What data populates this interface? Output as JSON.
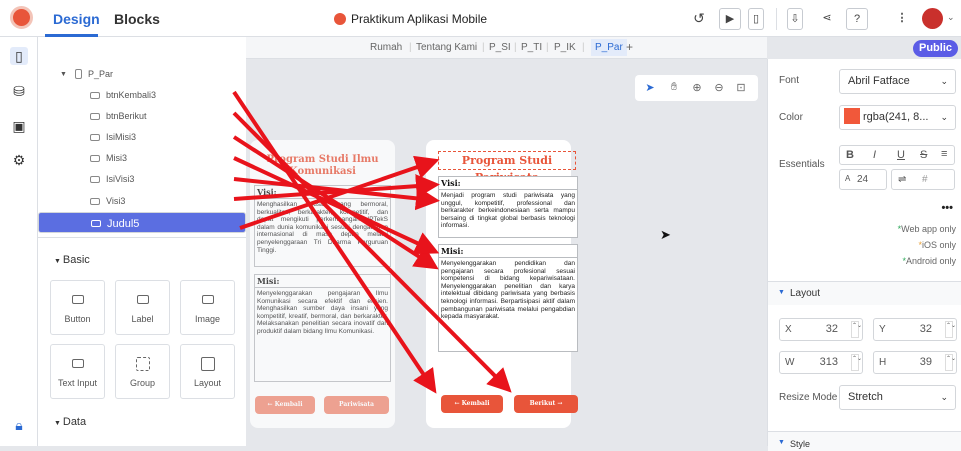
{
  "topbar": {
    "tabs": [
      {
        "label": "Design"
      },
      {
        "label": "Blocks"
      }
    ],
    "app_title": "Praktikum Aplikasi Mobile",
    "icons": [
      "history-icon",
      "preview-icon",
      "device-icon",
      "export-icon",
      "share-icon",
      "help-icon",
      "more-icon",
      "avatar-icon"
    ]
  },
  "tree": {
    "items": [
      {
        "label": "P_Par",
        "icon": "screen-icon"
      },
      {
        "label": "btnKembali3",
        "icon": "button-icon"
      },
      {
        "label": "btnBerikut",
        "icon": "button-icon"
      },
      {
        "label": "IsiMisi3",
        "icon": "label-icon"
      },
      {
        "label": "Misi3",
        "icon": "label-icon"
      },
      {
        "label": "IsiVisi3",
        "icon": "label-icon"
      },
      {
        "label": "Visi3",
        "icon": "label-icon"
      },
      {
        "label": "Judul5",
        "icon": "label-icon"
      }
    ]
  },
  "components": {
    "basic_label": "Basic",
    "data_label": "Data",
    "items": [
      {
        "label": "Button"
      },
      {
        "label": "Label"
      },
      {
        "label": "Image"
      },
      {
        "label": "Text Input"
      },
      {
        "label": "Group"
      },
      {
        "label": "Layout"
      }
    ]
  },
  "screens": {
    "items": [
      {
        "label": "Rumah"
      },
      {
        "label": "Tentang Kami"
      },
      {
        "label": "P_SI"
      },
      {
        "label": "P_TI"
      },
      {
        "label": "P_IK"
      },
      {
        "label": "P_Par"
      }
    ],
    "add_label": "+",
    "public_label": "Public"
  },
  "phone_left": {
    "title": "Program Studi Ilmu Komunikasi",
    "visi_heading": "Visi:",
    "visi_text": "Menghasilkan lulusan yang bermoral, berkualitas, berkarakter, kompetitif, dan dapat mengikuti perkembangan IPTekS dalam dunia komunikasi sesuai dengan tren internasional di masa depan melalui penyelenggaraan Tri Dharma Perguruan Tinggi.",
    "misi_heading": "Misi:",
    "misi_text": "Menyelenggarakan pengajaran Ilmu Komunikasi secara efektif dan efisien. Menghasilkan sumber daya insani yang kompetitif, kreatif, bermoral, dan berkarakter. Melaksanakan penelitian secara inovatif dan produktif dalam bidang Ilmu Komunikasi.",
    "btn_back": "← Kembali",
    "btn_next": "Pariwisata"
  },
  "phone_right": {
    "title": "Program Studi Pariwisata",
    "visi_heading": "Visi:",
    "visi_text": "Menjadi program studi pariwisata yang unggul, kompetitif, professional dan berkarakter berkeindonesiaan serta mampu bersaing di tingkat global berbasis teknologi informasi.",
    "misi_heading": "Misi:",
    "misi_text": "Menyelenggarakan pendidikan dan pengajaran secara profesional sesuai kompetensi di bidang kepariwisataan. Menyelenggarakan penelitian dan karya intelektual dibidang pariwisata yang berbasis teknologi informasi. Berpartisipasi aktif dalam pembangunan pariwisata melalui pengabdian kepada masyarakat.",
    "btn_back": "← Kembali",
    "btn_next": "Berikut →"
  },
  "props": {
    "font_label": "Font",
    "font_value": "Abril Fatface",
    "color_label": "Color",
    "color_value": "rgba(241, 8...",
    "color_swatch": "#f1583a",
    "essentials_label": "Essentials",
    "font_size": "24",
    "font_size_prefix": "A",
    "hash": "#",
    "more": "•••",
    "platforms": [
      {
        "label": "Web app only"
      },
      {
        "label": "iOS only"
      },
      {
        "label": "Android only"
      }
    ],
    "layout_label": "Layout",
    "x_label": "X",
    "x_value": "32",
    "y_label": "Y",
    "y_value": "32",
    "w_label": "W",
    "w_value": "313",
    "h_label": "H",
    "h_value": "39",
    "resize_label": "Resize Mode",
    "resize_value": "Stretch",
    "style_label": "Style"
  },
  "colors": {
    "accent": "#2b6ad3",
    "brand": "#e8553a",
    "selected": "#5b6ee1",
    "public": "#5b5ce6",
    "arrow": "#e8131b"
  }
}
